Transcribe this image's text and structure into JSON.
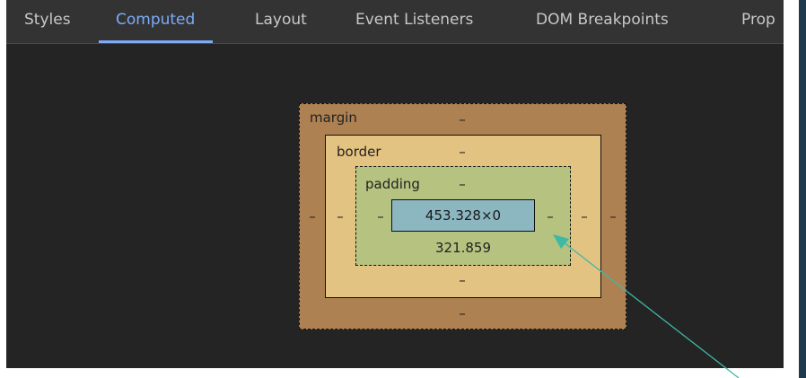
{
  "tabs": [
    {
      "label": "Styles"
    },
    {
      "label": "Computed"
    },
    {
      "label": "Layout"
    },
    {
      "label": "Event Listeners"
    },
    {
      "label": "DOM Breakpoints"
    },
    {
      "label": "Prop"
    }
  ],
  "active_tab": "Computed",
  "box_model": {
    "margin": {
      "label": "margin",
      "top": "–",
      "right": "–",
      "bottom": "–",
      "left": "–"
    },
    "border": {
      "label": "border",
      "top": "–",
      "right": "–",
      "bottom": "–",
      "left": "–"
    },
    "padding": {
      "label": "padding",
      "top": "–",
      "right": "–",
      "bottom": "321.859",
      "left": "–"
    },
    "content": {
      "size": "453.328×0"
    }
  },
  "colors": {
    "panel_bg": "#242424",
    "tabbar_bg": "#333333",
    "active_tab": "#7cacf8",
    "margin": "#ae8152",
    "border": "#e3c381",
    "padding": "#b6c27f",
    "content": "#8cb6c0",
    "annotation_arrow": "#3fb8a6"
  }
}
